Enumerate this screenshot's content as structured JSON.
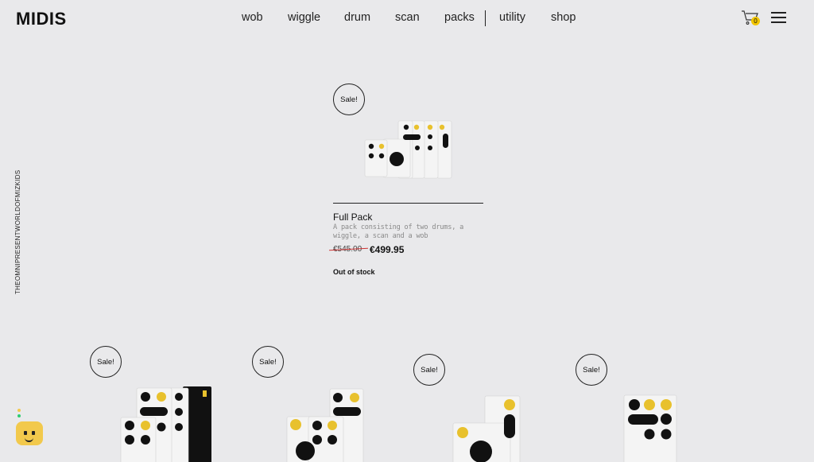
{
  "header": {
    "logo": "MIDIS",
    "nav": [
      {
        "id": "wob",
        "label": "wob"
      },
      {
        "id": "wiggle",
        "label": "wiggle"
      },
      {
        "id": "drum",
        "label": "drum"
      },
      {
        "id": "scan",
        "label": "scan"
      },
      {
        "id": "packs",
        "label": "packs"
      },
      {
        "id": "utility",
        "label": "utility"
      },
      {
        "id": "shop",
        "label": "shop"
      }
    ],
    "cart_count": "0"
  },
  "side_text": "THEOMNIPRESENTWORLDOFMIZKIDS",
  "featured": {
    "badge": "Sale!",
    "title": "Full Pack",
    "description": "A pack consisting of two drums, a wiggle, a scan and a wob",
    "old_price": "€545.00",
    "new_price": "€499.95",
    "stock": "Out of stock"
  },
  "grid": [
    {
      "badge": "Sale!"
    },
    {
      "badge": "Sale!"
    },
    {
      "badge": "Sale!"
    },
    {
      "badge": "Sale!"
    }
  ],
  "colors": {
    "background": "#e9e9eb",
    "accent": "#f2c500",
    "dark": "#111111",
    "sale_strike": "#cc3333"
  },
  "icons": [
    "cart-icon",
    "menu-icon",
    "chat-widget-icon"
  ]
}
